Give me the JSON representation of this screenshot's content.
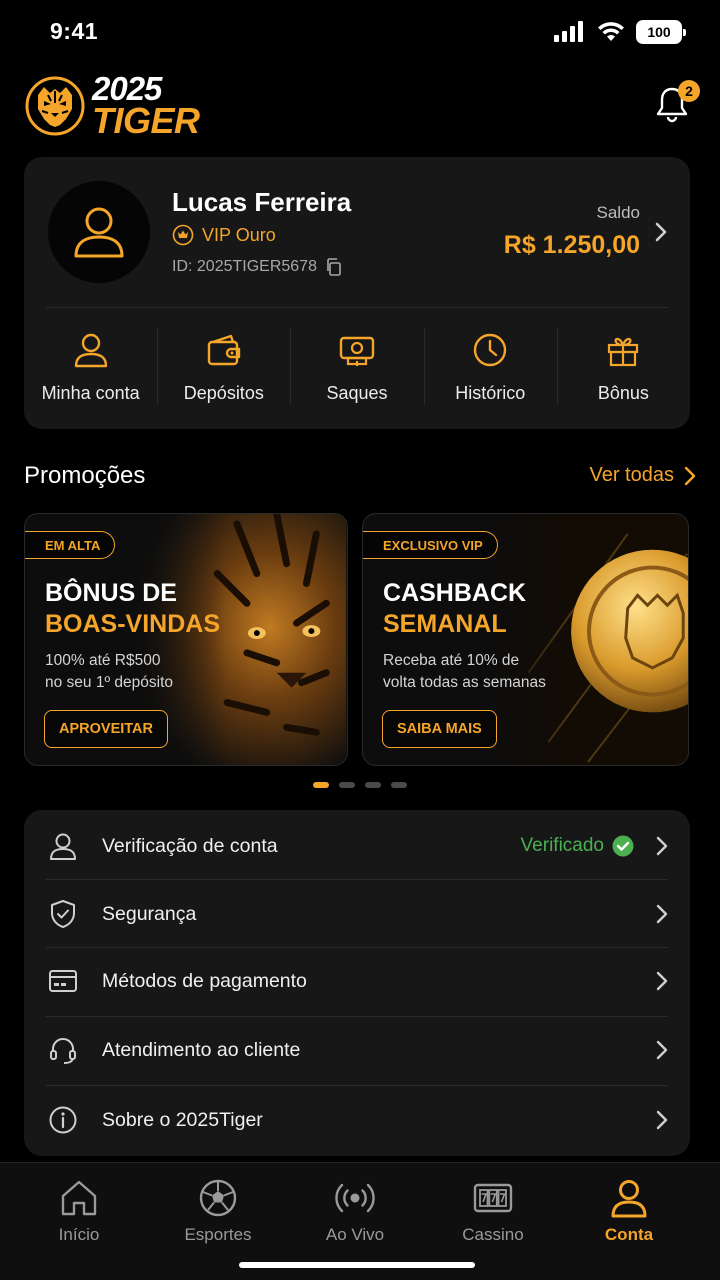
{
  "status_bar": {
    "time": "9:41",
    "battery": "100"
  },
  "header": {
    "logo_year": "2025",
    "logo_name": "TIGER",
    "notification_count": "2"
  },
  "profile": {
    "name": "Lucas Ferreira",
    "vip_level": "VIP Ouro",
    "user_id": "ID: 2025TIGER5678",
    "balance_label": "Saldo",
    "balance_value": "R$ 1.250,00"
  },
  "quick_actions": [
    {
      "label": "Minha conta",
      "icon": "user-icon"
    },
    {
      "label": "Depósitos",
      "icon": "wallet-icon"
    },
    {
      "label": "Saques",
      "icon": "cash-icon"
    },
    {
      "label": "Histórico",
      "icon": "clock-icon"
    },
    {
      "label": "Bônus",
      "icon": "gift-icon"
    }
  ],
  "promotions": {
    "title": "Promoções",
    "see_all": "Ver todas",
    "cards": [
      {
        "tag": "EM ALTA",
        "title_line1": "BÔNUS DE",
        "title_line2": "BOAS-VINDAS",
        "desc_line1": "100% até R$500",
        "desc_line2": "no seu 1º depósito",
        "button": "APROVEITAR"
      },
      {
        "tag": "EXCLUSIVO VIP",
        "title_line1": "CASHBACK",
        "title_line2": "SEMANAL",
        "desc_line1": "Receba até 10% de",
        "desc_line2": "volta todas as semanas",
        "button": "SAIBA MAIS"
      }
    ],
    "carousel_active_index": 0,
    "carousel_count": 4
  },
  "menu": [
    {
      "label": "Verificação de conta",
      "icon": "user-outline-icon",
      "status": "Verificado"
    },
    {
      "label": "Segurança",
      "icon": "shield-check-icon"
    },
    {
      "label": "Métodos de pagamento",
      "icon": "credit-card-icon"
    },
    {
      "label": "Atendimento ao cliente",
      "icon": "headset-icon"
    },
    {
      "label": "Sobre o 2025Tiger",
      "icon": "info-icon"
    }
  ],
  "bottom_nav": [
    {
      "label": "Início",
      "icon": "home-icon"
    },
    {
      "label": "Esportes",
      "icon": "soccer-ball-icon"
    },
    {
      "label": "Ao Vivo",
      "icon": "live-broadcast-icon"
    },
    {
      "label": "Cassino",
      "icon": "slot-machine-icon"
    },
    {
      "label": "Conta",
      "icon": "account-icon",
      "active": true
    }
  ],
  "colors": {
    "accent": "#f4a52a",
    "card_bg": "#171717",
    "success": "#4caf50",
    "background": "#000000"
  }
}
